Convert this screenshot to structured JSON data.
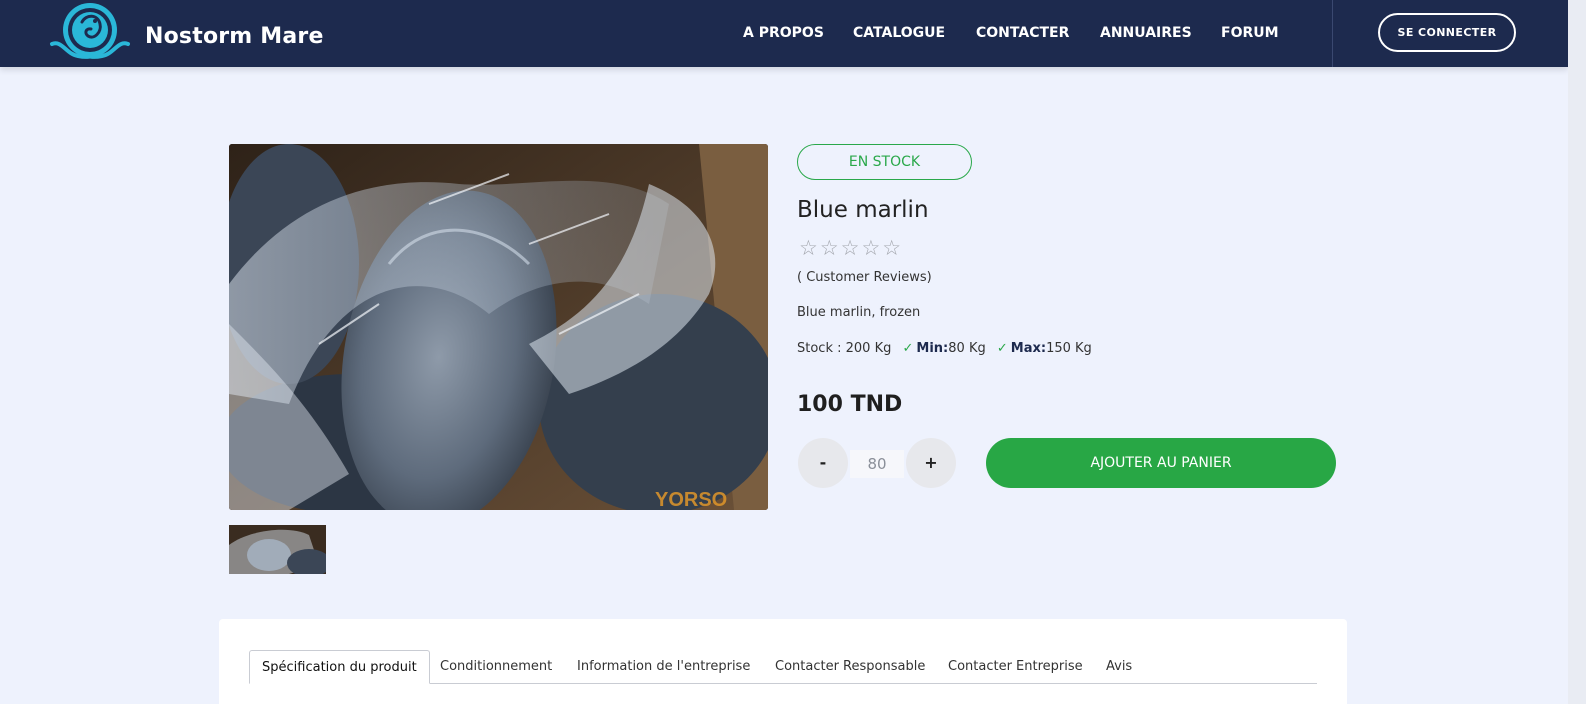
{
  "header": {
    "brand": "Nostorm Mare",
    "logo_icon": "fish-wave-logo-icon",
    "nav": [
      "A PROPOS",
      "CATALOGUE",
      "CONTACTER",
      "ANNUAIRES",
      "FORUM"
    ],
    "login_label": "SE CONNECTER"
  },
  "product": {
    "stock_badge": "EN STOCK",
    "title": "Blue marlin",
    "rating_stars": "☆☆☆☆☆",
    "rating": 0,
    "rating_max": 5,
    "reviews_label": "( Customer Reviews)",
    "description": "Blue marlin, frozen",
    "stock_label": "Stock : 200 Kg",
    "check_mark": "✓",
    "min_label": "Min:",
    "min_value": "80 Kg",
    "max_label": "Max:",
    "max_value": "150 Kg",
    "price": "100 TND",
    "watermark": "YORSO",
    "image_icon": "frozen-fish-photo",
    "thumb_icon": "frozen-fish-thumbnail"
  },
  "quantity": {
    "minus_label": "-",
    "plus_label": "+",
    "value": "80"
  },
  "cart": {
    "label": "AJOUTER AU PANIER"
  },
  "tabs": [
    "Spécification du produit",
    "Conditionnement",
    "Information de l'entreprise",
    "Contacter Responsable",
    "Contacter Entreprise",
    "Avis"
  ],
  "colors": {
    "header_bg": "#1d2a4e",
    "page_bg": "#eef2fd",
    "accent_green": "#28a745",
    "logo_teal": "#2ab7d8"
  }
}
